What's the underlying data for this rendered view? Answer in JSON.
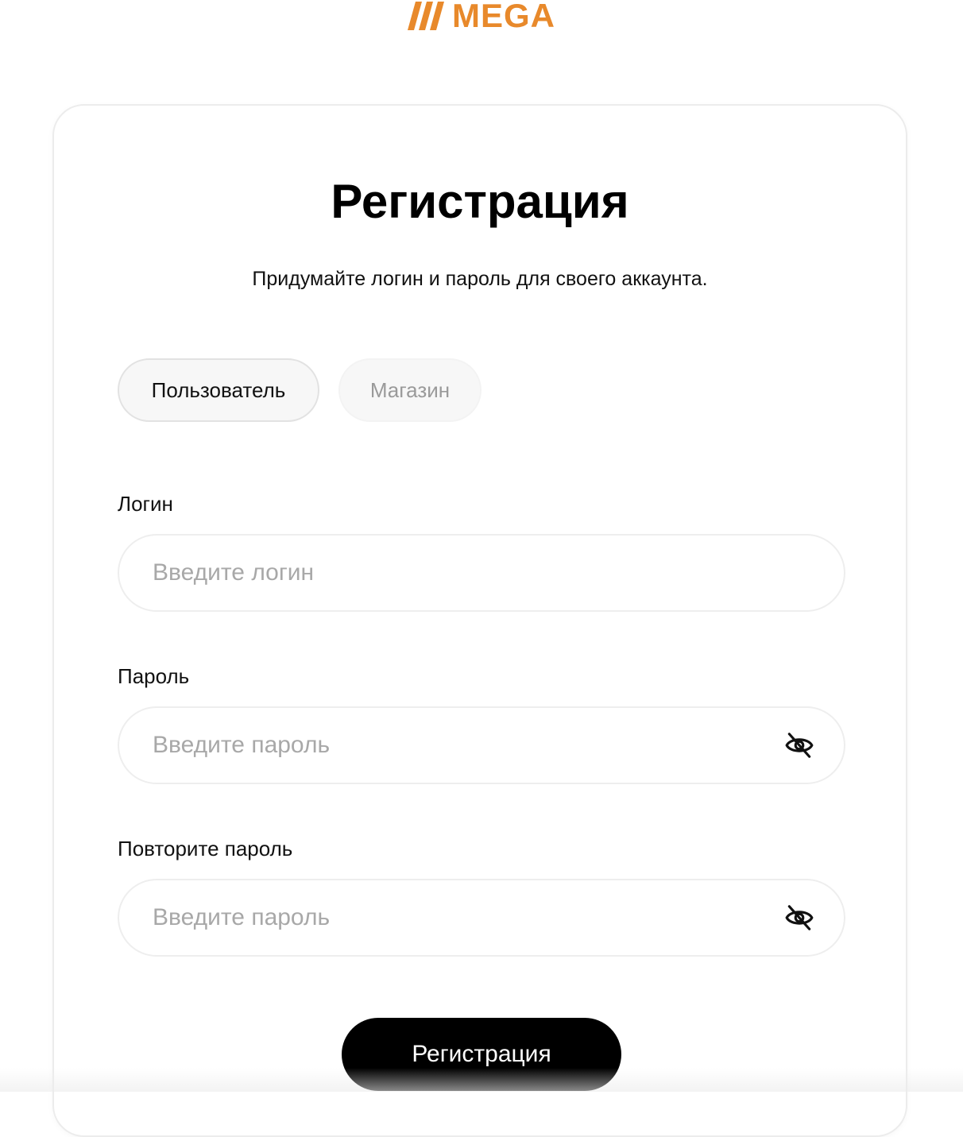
{
  "brand": {
    "name": "MEGA",
    "color": "#E8892B"
  },
  "form": {
    "title": "Регистрация",
    "subtitle": "Придумайте логин и пароль для своего аккаунта.",
    "tabs": [
      {
        "label": "Пользователь",
        "active": true
      },
      {
        "label": "Магазин",
        "active": false
      }
    ],
    "login": {
      "label": "Логин",
      "value": "",
      "placeholder": "Введите логин"
    },
    "password": {
      "label": "Пароль",
      "value": "",
      "placeholder": "Введите пароль",
      "toggle_icon": "eye-off-icon"
    },
    "password_repeat": {
      "label": "Повторите пароль",
      "value": "",
      "placeholder": "Введите пароль",
      "toggle_icon": "eye-off-icon"
    },
    "submit_label": "Регистрация",
    "submit_color": "#000000"
  }
}
